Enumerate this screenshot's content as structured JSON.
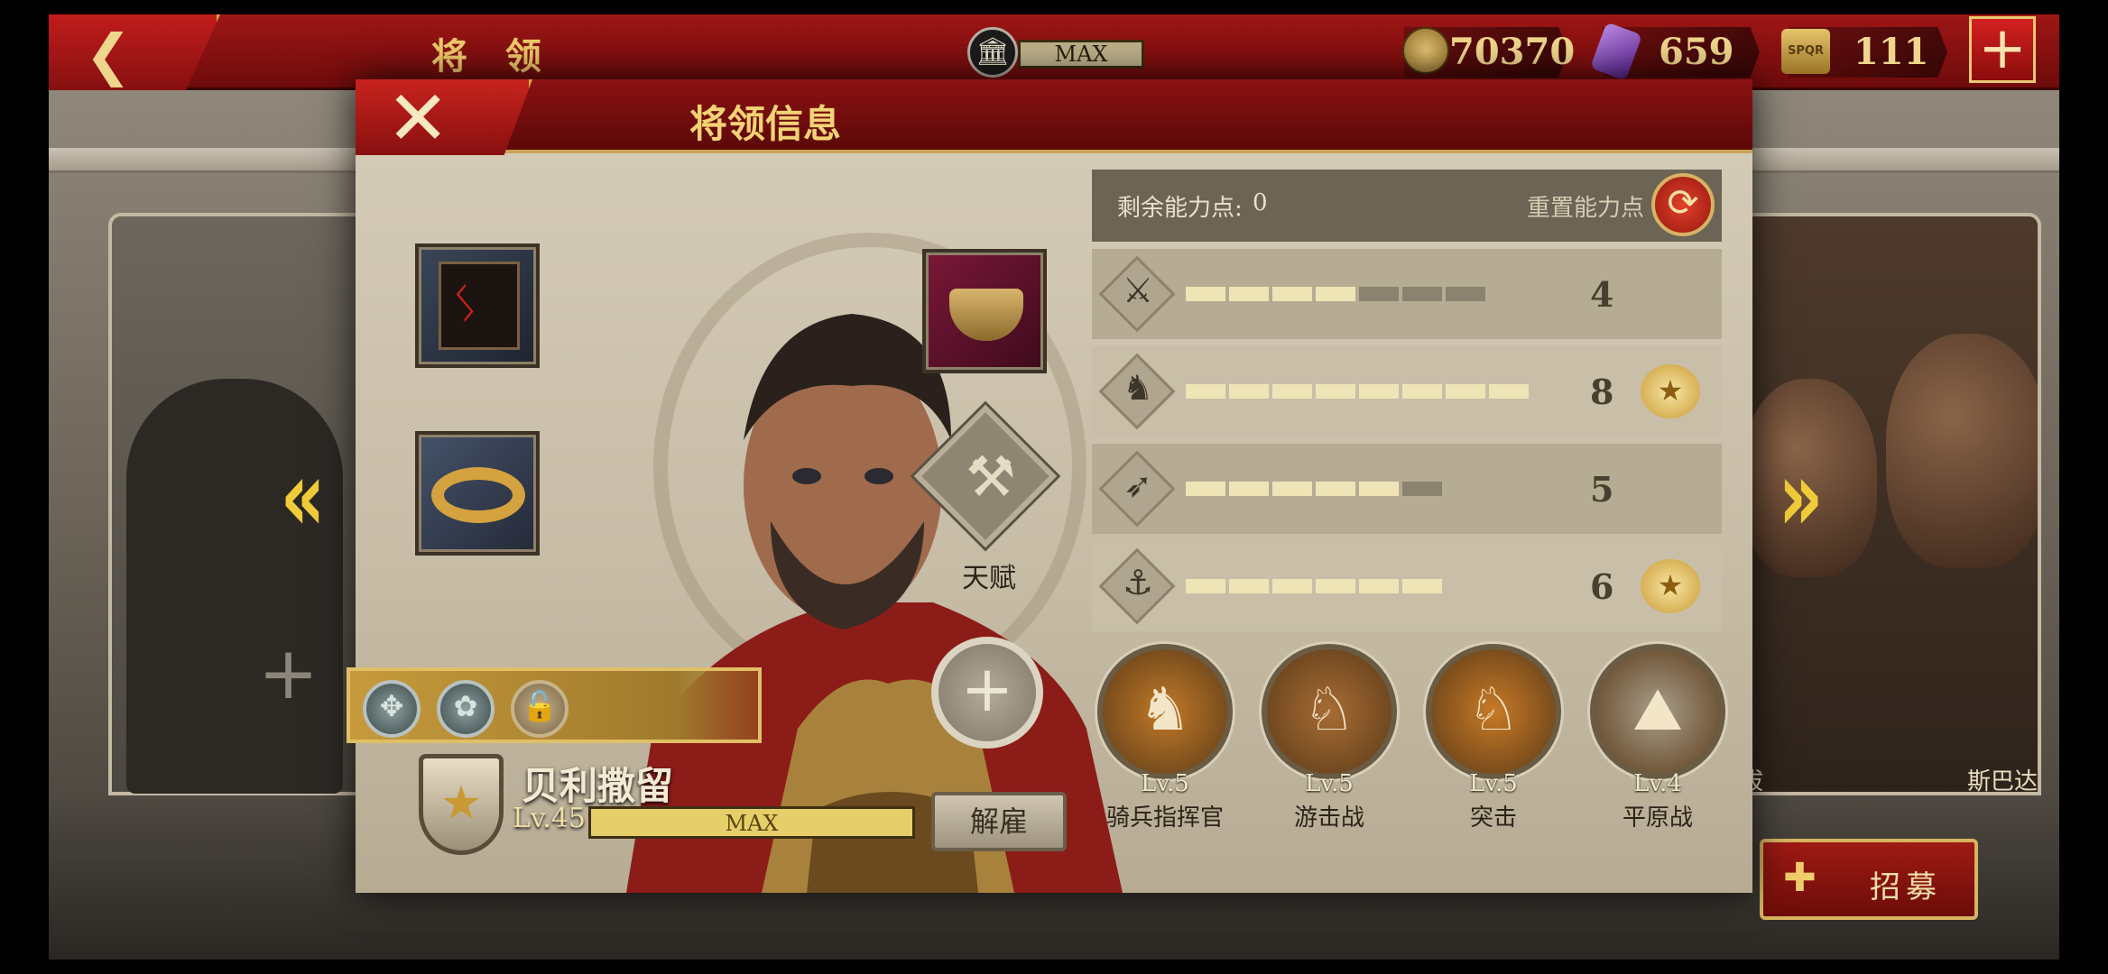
{
  "topbar": {
    "title": "将 领",
    "building_level": "MAX",
    "coins": "70370",
    "gems": "659",
    "tokens": "111",
    "tokens_icon_text": "SPQR",
    "add_icon": "plus-icon"
  },
  "dialog": {
    "title": "将领信息",
    "close_icon": "close-icon"
  },
  "equipment": {
    "banner": "banner-icon",
    "wreath": "laurel-wreath-icon",
    "cauldron": "bronze-cauldron-icon",
    "talent_label": "天赋"
  },
  "general": {
    "name": "贝利撒留",
    "level": "Lv.45",
    "xp_text": "MAX",
    "xp_fraction": 1.0,
    "dismiss_label": "解雇"
  },
  "stats": {
    "points_label": "剩余能力点:",
    "points_value": "0",
    "reset_label": "重置能力点",
    "rows": [
      {
        "icon": "sword-icon",
        "glyph": "⚔",
        "value": "4",
        "pips_on": 4,
        "pips_total": 7,
        "max_pips": 7,
        "badge": false
      },
      {
        "icon": "horse-icon",
        "glyph": "♞",
        "value": "8",
        "pips_on": 8,
        "pips_total": 8,
        "max_pips": 8,
        "badge": true
      },
      {
        "icon": "bow-icon",
        "glyph": "➶",
        "value": "5",
        "pips_on": 5,
        "pips_total": 6,
        "max_pips": 6,
        "badge": false
      },
      {
        "icon": "anchor-icon",
        "glyph": "⚓",
        "value": "6",
        "pips_on": 6,
        "pips_total": 6,
        "max_pips": 6,
        "badge": true
      }
    ]
  },
  "abilities": [
    {
      "icon": "horse-head-icon",
      "glyph": "♞",
      "level": "Lv.5",
      "name": "骑兵指挥官",
      "color": "#c27a28"
    },
    {
      "icon": "skirmish-riders-icon",
      "glyph": "♘",
      "level": "Lv.5",
      "name": "游击战",
      "color": "#a86c34"
    },
    {
      "icon": "charging-rider-icon",
      "glyph": "♘",
      "level": "Lv.5",
      "name": "突击",
      "color": "#c87a26"
    },
    {
      "icon": "plains-icon",
      "glyph": "⛰",
      "level": "Lv.4",
      "name": "平原战",
      "color": "#a89e8a"
    }
  ],
  "background": {
    "right_card_name_left": "拔",
    "right_card_name_right": "斯巴达",
    "recruit_label": "招募"
  },
  "colors": {
    "accent_red": "#8c1212",
    "gold": "#f3d374",
    "panel": "#c7bca6"
  }
}
